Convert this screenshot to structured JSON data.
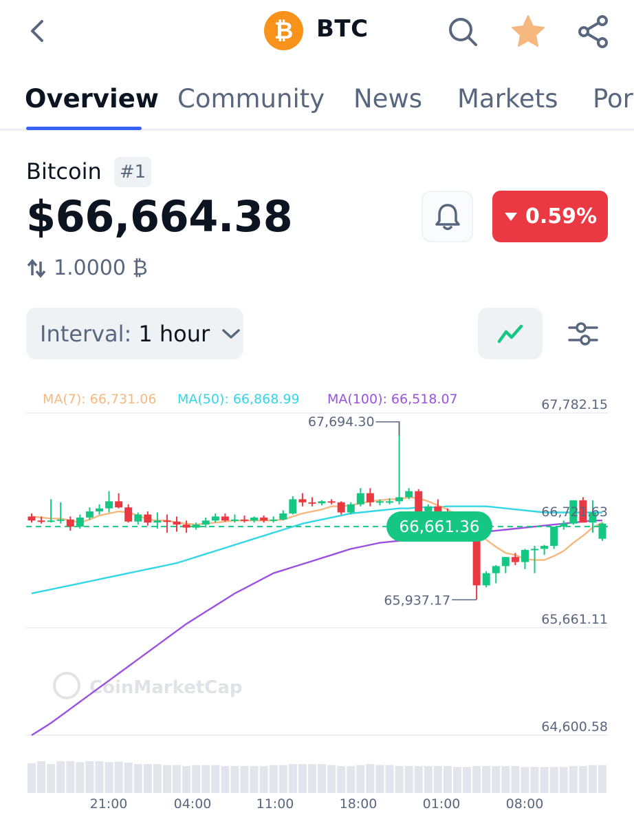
{
  "header": {
    "title": "BTC",
    "coin_symbol_glyph": "₿",
    "icons": [
      "chevron-left-icon",
      "bitcoin-logo",
      "search-icon",
      "star-icon",
      "share-icon"
    ],
    "colors": {
      "star": "#f6b87e",
      "bitcoin_orange": "#f7931a"
    }
  },
  "tabs": [
    {
      "label": "Overview",
      "active": true
    },
    {
      "label": "Community",
      "active": false
    },
    {
      "label": "News",
      "active": false
    },
    {
      "label": "Markets",
      "active": false
    },
    {
      "label": "Por",
      "active": false
    }
  ],
  "coin": {
    "name": "Bitcoin",
    "rank": "#1",
    "price": "$66,664.38",
    "change": "0.59%",
    "change_direction": "down",
    "conversion": "1.0000 ₿"
  },
  "controls": {
    "interval_label": "Interval:",
    "interval_value": "1 hour"
  },
  "chart_data": {
    "type": "candlestick",
    "ma_legend": [
      {
        "label": "MA(7): 66,731.06",
        "color": "#f6b87e"
      },
      {
        "label": "MA(50): 66,868.99",
        "color": "#33d6e6"
      },
      {
        "label": "MA(100): 66,518.07",
        "color": "#9b51e0"
      }
    ],
    "y_ticks": [
      "67,782.15",
      "66,721.63",
      "65,661.11",
      "64,600.58"
    ],
    "y_tick_values": [
      67782.15,
      66721.63,
      65661.11,
      64600.58
    ],
    "ylim": [
      64600.58,
      67782.15
    ],
    "x_ticks": [
      "21:00",
      "04:00",
      "11:00",
      "18:00",
      "01:00",
      "08:00"
    ],
    "high_label": "67,694.30",
    "high_value": 67694.3,
    "low_label": "65,937.17",
    "low_value": 65937.17,
    "current_price_label": "66,661.36",
    "current_price": 66661.36,
    "watermark": "CoinMarketCap",
    "colors": {
      "up": "#16c784",
      "down": "#ea3943",
      "ma7": "#f6b87e",
      "ma50": "#33d6e6",
      "ma100": "#9b51e0",
      "price_line": "#16c784"
    },
    "candles": [
      [
        66760,
        66790,
        66700,
        66720
      ],
      [
        66720,
        66760,
        66690,
        66710
      ],
      [
        66710,
        66930,
        66700,
        66720
      ],
      [
        66720,
        66900,
        66690,
        66730
      ],
      [
        66730,
        66760,
        66620,
        66660
      ],
      [
        66660,
        66780,
        66640,
        66750
      ],
      [
        66750,
        66850,
        66730,
        66810
      ],
      [
        66810,
        66880,
        66780,
        66840
      ],
      [
        66840,
        67010,
        66800,
        66910
      ],
      [
        66910,
        66990,
        66840,
        66850
      ],
      [
        66850,
        66880,
        66700,
        66710
      ],
      [
        66710,
        66800,
        66680,
        66780
      ],
      [
        66780,
        66810,
        66670,
        66700
      ],
      [
        66700,
        66800,
        66640,
        66720
      ],
      [
        66720,
        66780,
        66600,
        66710
      ],
      [
        66710,
        66760,
        66610,
        66680
      ],
      [
        66680,
        66720,
        66600,
        66650
      ],
      [
        66650,
        66700,
        66630,
        66680
      ],
      [
        66680,
        66750,
        66650,
        66720
      ],
      [
        66720,
        66790,
        66700,
        66760
      ],
      [
        66760,
        66790,
        66710,
        66720
      ],
      [
        66720,
        66780,
        66700,
        66730
      ],
      [
        66730,
        66770,
        66700,
        66720
      ],
      [
        66720,
        66760,
        66700,
        66750
      ],
      [
        66750,
        66770,
        66700,
        66720
      ],
      [
        66720,
        66760,
        66700,
        66730
      ],
      [
        66730,
        66820,
        66720,
        66790
      ],
      [
        66790,
        66960,
        66780,
        66930
      ],
      [
        66930,
        66990,
        66860,
        66900
      ],
      [
        66900,
        66950,
        66860,
        66890
      ],
      [
        66890,
        66920,
        66870,
        66910
      ],
      [
        66910,
        66930,
        66880,
        66900
      ],
      [
        66900,
        66910,
        66780,
        66800
      ],
      [
        66800,
        66900,
        66780,
        66880
      ],
      [
        66880,
        67040,
        66860,
        66990
      ],
      [
        66990,
        67040,
        66860,
        66900
      ],
      [
        66900,
        66930,
        66870,
        66910
      ],
      [
        66910,
        66940,
        66880,
        66910
      ],
      [
        66910,
        67694,
        66880,
        66950
      ],
      [
        66950,
        67040,
        66930,
        67010
      ],
      [
        67010,
        67030,
        66700,
        66700
      ],
      [
        66700,
        66880,
        66680,
        66860
      ],
      [
        66860,
        66930,
        66690,
        66720
      ],
      [
        66720,
        66840,
        66660,
        66690
      ],
      [
        66690,
        66790,
        66620,
        66640
      ],
      [
        66640,
        66690,
        66560,
        66580
      ],
      [
        66580,
        66600,
        65940,
        66080
      ],
      [
        66080,
        66220,
        66060,
        66200
      ],
      [
        66200,
        66280,
        66100,
        66270
      ],
      [
        66270,
        66360,
        66200,
        66360
      ],
      [
        66360,
        66400,
        66280,
        66310
      ],
      [
        66310,
        66440,
        66240,
        66430
      ],
      [
        66430,
        66470,
        66200,
        66440
      ],
      [
        66440,
        66480,
        66380,
        66470
      ],
      [
        66470,
        66640,
        66440,
        66660
      ],
      [
        66660,
        66720,
        66630,
        66690
      ],
      [
        66690,
        66920,
        66680,
        66920
      ],
      [
        66920,
        66950,
        66700,
        66700
      ],
      [
        66700,
        66920,
        66600,
        66800
      ],
      [
        66540,
        66700,
        66520,
        66690
      ]
    ],
    "ma7": [
      66760,
      66750,
      66740,
      66740,
      66720,
      66700,
      66730,
      66770,
      66790,
      66810,
      66800,
      66770,
      66730,
      66720,
      66720,
      66700,
      66690,
      66680,
      66690,
      66700,
      66710,
      66720,
      66720,
      66720,
      66720,
      66720,
      66730,
      66760,
      66790,
      66810,
      66830,
      66860,
      66860,
      66870,
      66890,
      66910,
      66920,
      66930,
      66930,
      66950,
      66940,
      66910,
      66870,
      66830,
      66770,
      66700,
      66600,
      66530,
      66460,
      66400,
      66380,
      66340,
      66330,
      66330,
      66370,
      66420,
      66500,
      66570,
      66650,
      66700
    ],
    "ma50": [
      66000,
      66020,
      66040,
      66060,
      66080,
      66100,
      66120,
      66140,
      66160,
      66180,
      66200,
      66220,
      66240,
      66260,
      66280,
      66300,
      66330,
      66360,
      66390,
      66420,
      66450,
      66480,
      66510,
      66540,
      66570,
      66600,
      66630,
      66660,
      66690,
      66710,
      66730,
      66750,
      66770,
      66790,
      66800,
      66810,
      66820,
      66830,
      66840,
      66840,
      66850,
      66850,
      66850,
      66860,
      66860,
      66860,
      66860,
      66860,
      66850,
      66840,
      66830,
      66820,
      66810,
      66800,
      66800,
      66800,
      66800,
      66800,
      66800,
      66800
    ],
    "ma100": [
      64600,
      64660,
      64720,
      64790,
      64860,
      64930,
      65000,
      65070,
      65140,
      65210,
      65280,
      65350,
      65420,
      65490,
      65560,
      65630,
      65700,
      65760,
      65820,
      65880,
      65940,
      66000,
      66050,
      66100,
      66150,
      66200,
      66230,
      66260,
      66290,
      66320,
      66350,
      66380,
      66410,
      66440,
      66460,
      66480,
      66500,
      66510,
      66520,
      66530,
      66540,
      66550,
      66560,
      66570,
      66580,
      66590,
      66600,
      66610,
      66620,
      66630,
      66640,
      66650,
      66660,
      66670,
      66680,
      66690,
      66700,
      66710,
      66720,
      66720
    ],
    "volume": [
      0.62,
      0.66,
      0.6,
      0.66,
      0.66,
      0.64,
      0.66,
      0.66,
      0.64,
      0.65,
      0.63,
      0.6,
      0.6,
      0.6,
      0.58,
      0.58,
      0.56,
      0.58,
      0.58,
      0.58,
      0.56,
      0.56,
      0.56,
      0.56,
      0.56,
      0.58,
      0.58,
      0.6,
      0.6,
      0.6,
      0.6,
      0.58,
      0.56,
      0.56,
      0.58,
      0.6,
      0.58,
      0.58,
      0.56,
      0.56,
      0.56,
      0.56,
      0.56,
      0.56,
      0.54,
      0.54,
      0.56,
      0.56,
      0.56,
      0.56,
      0.56,
      0.54,
      0.54,
      0.54,
      0.54,
      0.54,
      0.56,
      0.56,
      0.58,
      0.58
    ]
  }
}
